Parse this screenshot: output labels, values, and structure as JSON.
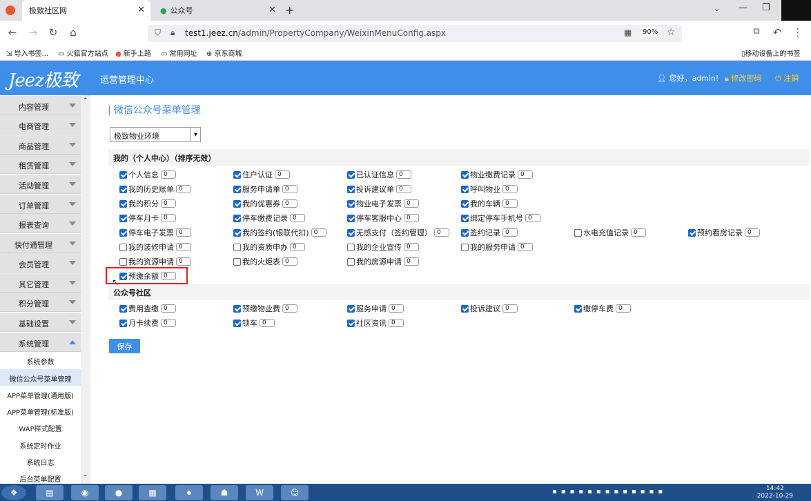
{
  "browser": {
    "tabs": [
      {
        "label": "极致社区网",
        "active": true
      },
      {
        "label": "公众号",
        "active": false
      }
    ],
    "new_tab": "+",
    "url_host": "test1.jeez.cn",
    "url_path": "/admin/PropertyCompany/WeixinMenuConfig.aspx",
    "zoom": "90%",
    "bookmarks": [
      "导入书签...",
      "火狐官方站点",
      "新手上路",
      "常用网址",
      "京东商城"
    ],
    "mobile_bookmarks": "移动设备上的书签"
  },
  "header": {
    "logo": "Jeez极致",
    "title": "运营管理中心",
    "greeting": "您好，admin!",
    "change_password": "修改密码",
    "logout": "注销",
    "color": "#3f8fea"
  },
  "sidebar": {
    "items": [
      {
        "label": "内容管理"
      },
      {
        "label": "电商管理"
      },
      {
        "label": "商品管理"
      },
      {
        "label": "租赁管理"
      },
      {
        "label": "活动管理"
      },
      {
        "label": "订单管理"
      },
      {
        "label": "报表查询"
      },
      {
        "label": "快付通管理"
      },
      {
        "label": "会员管理"
      },
      {
        "label": "其它管理"
      },
      {
        "label": "积分管理"
      },
      {
        "label": "基础设置"
      },
      {
        "label": "系统管理",
        "expanded": true
      }
    ],
    "subitems": [
      {
        "label": "系统参数"
      },
      {
        "label": "微信公众号菜单管理",
        "active": true
      },
      {
        "label": "APP菜单管理(通用版)"
      },
      {
        "label": "APP菜单管理(标准版)"
      },
      {
        "label": "WAP样式配置"
      },
      {
        "label": "系统定时作业"
      },
      {
        "label": "系统日志"
      },
      {
        "label": "后台菜单配置"
      }
    ]
  },
  "main": {
    "page_title": "微信公众号菜单管理",
    "select_value": "极致物业环境",
    "section1_title": "我的（个人中心）（排序无效）",
    "section1_items": [
      {
        "label": "个人信息",
        "checked": true,
        "value": "0"
      },
      {
        "label": "住户认证",
        "checked": true,
        "value": "0"
      },
      {
        "label": "已认证信息",
        "checked": true,
        "value": "0"
      },
      {
        "label": "物业缴费记录",
        "checked": true,
        "value": "0"
      },
      {
        "label": "我的历史账单",
        "checked": true,
        "value": "0"
      },
      {
        "label": "服务申请单",
        "checked": true,
        "value": "0"
      },
      {
        "label": "投诉建议单",
        "checked": true,
        "value": "0"
      },
      {
        "label": "呼叫物业",
        "checked": true,
        "value": "0"
      },
      {
        "label": "我的积分",
        "checked": true,
        "value": "0"
      },
      {
        "label": "我的优惠券",
        "checked": true,
        "value": "0"
      },
      {
        "label": "物业电子发票",
        "checked": true,
        "value": "0"
      },
      {
        "label": "我的车辆",
        "checked": true,
        "value": "0"
      },
      {
        "label": "停车月卡",
        "checked": true,
        "value": "0"
      },
      {
        "label": "停车缴费记录",
        "checked": true,
        "value": "0"
      },
      {
        "label": "停车客服中心",
        "checked": true,
        "value": "0"
      },
      {
        "label": "绑定停车手机号",
        "checked": true,
        "value": "0"
      },
      {
        "label": "停车电子发票",
        "checked": true,
        "value": "0"
      },
      {
        "label": "我的签约(银联代扣)",
        "checked": true,
        "value": "0"
      },
      {
        "label": "无感支付（签约管理）",
        "checked": true,
        "value": "0"
      },
      {
        "label": "签约记录",
        "checked": true,
        "value": "0"
      },
      {
        "label": "水电充值记录",
        "checked": false,
        "value": "0"
      },
      {
        "label": "预约看房记录",
        "checked": true,
        "value": "0"
      },
      {
        "label": "我的装修申请",
        "checked": false,
        "value": "0"
      },
      {
        "label": "我的资质申办",
        "checked": false,
        "value": "0"
      },
      {
        "label": "我的企业宣传",
        "checked": false,
        "value": "0"
      },
      {
        "label": "我的服务申请",
        "checked": false,
        "value": "0"
      },
      {
        "label": "我的资源申请",
        "checked": false,
        "value": "0"
      },
      {
        "label": "我的火炬表",
        "checked": false,
        "value": "0"
      },
      {
        "label": "我的房源申请",
        "checked": false,
        "value": "0"
      },
      {
        "label": "预缴余额",
        "checked": true,
        "value": "0"
      }
    ],
    "section2_title": "公众号社区",
    "section2_items": [
      {
        "label": "费用查缴",
        "checked": true,
        "value": "0"
      },
      {
        "label": "预缴物业费",
        "checked": true,
        "value": "0"
      },
      {
        "label": "服务申请",
        "checked": true,
        "value": "0"
      },
      {
        "label": "投诉建议",
        "checked": true,
        "value": "0"
      },
      {
        "label": "缴停车费",
        "checked": true,
        "value": "0"
      },
      {
        "label": "月卡续费",
        "checked": true,
        "value": "0"
      },
      {
        "label": "锁车",
        "checked": true,
        "value": "0"
      },
      {
        "label": "社区资讯",
        "checked": true,
        "value": "0"
      }
    ],
    "save_label": "保存",
    "highlight_color": "#e02020"
  },
  "taskbar": {
    "time": "14:42",
    "date": "2022-10-29"
  }
}
